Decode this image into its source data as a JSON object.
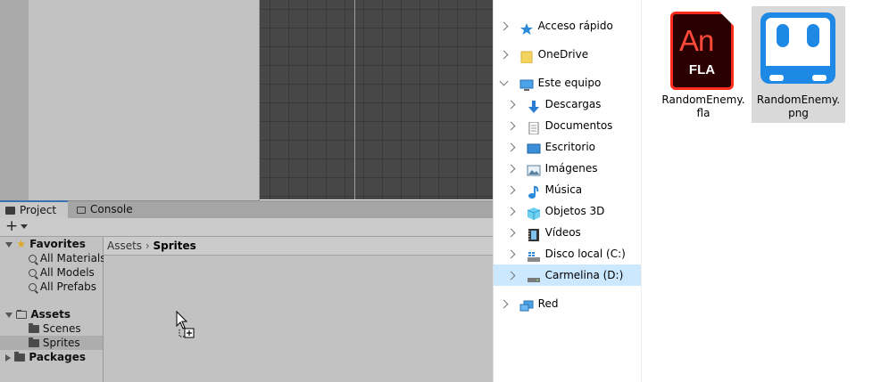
{
  "unity": {
    "tabs": [
      {
        "label": "Project",
        "active": true
      },
      {
        "label": "Console",
        "active": false
      }
    ],
    "toolbar": {
      "add_label": "+"
    },
    "tree": {
      "favorites_label": "Favorites",
      "favorites_items": [
        "All Materials",
        "All Models",
        "All Prefabs"
      ],
      "assets_label": "Assets",
      "assets_items": [
        "Scenes",
        "Sprites"
      ],
      "selected_item": "Sprites",
      "packages_label": "Packages"
    },
    "breadcrumb": {
      "parent": "Assets",
      "separator": "›",
      "current": "Sprites"
    }
  },
  "explorer": {
    "nav": {
      "quick_access": "Acceso rápido",
      "onedrive": "OneDrive",
      "this_pc": "Este equipo",
      "pc_items": [
        "Descargas",
        "Documentos",
        "Escritorio",
        "Imágenes",
        "Música",
        "Objetos 3D",
        "Vídeos",
        "Disco local (C:)",
        "Carmelina (D:)"
      ],
      "selected": "Carmelina (D:)",
      "network": "Red"
    },
    "files": [
      {
        "name": "RandomEnemy.fla",
        "icon": "animate-fla-icon",
        "badge": "An",
        "sub": "FLA"
      },
      {
        "name": "RandomEnemy.png",
        "icon": "robot-face-icon",
        "selected": true
      }
    ]
  },
  "colors": {
    "unity_panel": "#c2c2c2",
    "scene_bg": "#474747",
    "explorer_selection": "#cce8ff",
    "an_red": "#ff2b1c",
    "robot_blue": "#1e88e5"
  }
}
